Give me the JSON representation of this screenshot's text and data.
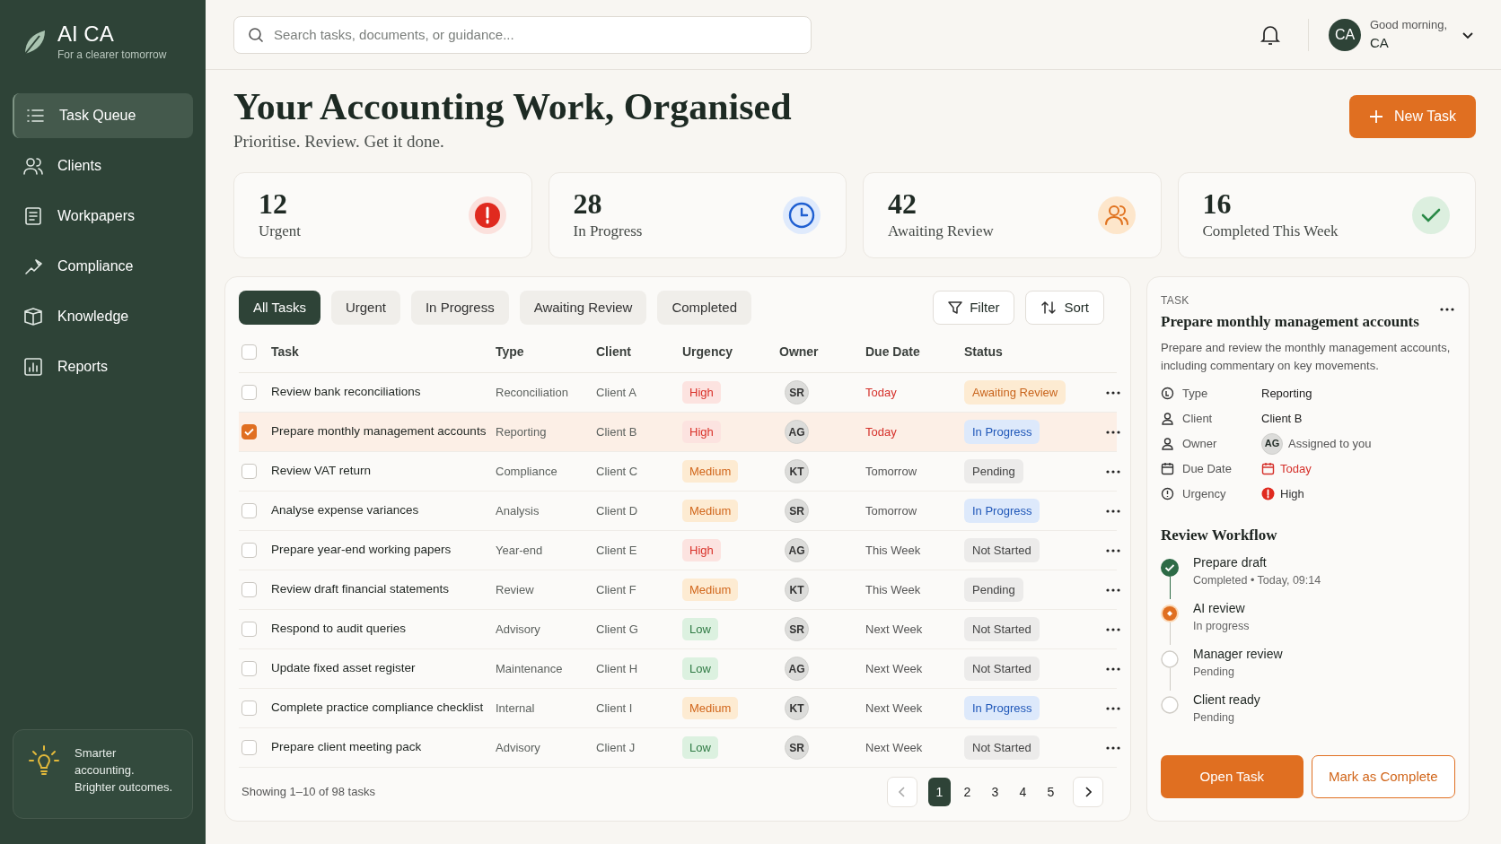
{
  "brand": {
    "name": "AI CA",
    "tagline": "For a clearer tomorrow"
  },
  "nav": [
    {
      "label": "Task Queue",
      "selected": true
    },
    {
      "label": "Clients",
      "selected": false
    },
    {
      "label": "Workpapers",
      "selected": false
    },
    {
      "label": "Compliance",
      "selected": false
    },
    {
      "label": "Knowledge",
      "selected": false
    },
    {
      "label": "Reports",
      "selected": false
    }
  ],
  "promo": "Smarter accounting. Brighter outcomes.",
  "header": {
    "search_placeholder": "Search tasks, documents, or guidance...",
    "greeting": "Good morning,",
    "user": "CA",
    "avatar": "CA"
  },
  "page": {
    "title": "Your Accounting Work, Organised",
    "subtitle": "Prioritise. Review. Get it done.",
    "new_button": "New Task"
  },
  "stats": [
    {
      "value": "12",
      "label": "Urgent",
      "kind": "urgent"
    },
    {
      "value": "28",
      "label": "In Progress",
      "kind": "progress"
    },
    {
      "value": "42",
      "label": "Awaiting Review",
      "kind": "review"
    },
    {
      "value": "16",
      "label": "Completed This Week",
      "kind": "done"
    }
  ],
  "tabs": [
    {
      "label": "All Tasks",
      "selected": true
    },
    {
      "label": "Urgent",
      "selected": false
    },
    {
      "label": "In Progress",
      "selected": false
    },
    {
      "label": "Awaiting Review",
      "selected": false
    },
    {
      "label": "Completed",
      "selected": false
    }
  ],
  "filter_button": "Filter",
  "sort_button": "Sort",
  "table": {
    "select_all_checked": false,
    "columns": [
      "Task",
      "Type",
      "Client",
      "Urgency",
      "Owner",
      "Due Date",
      "Status"
    ],
    "rows": [
      {
        "task": "Review bank reconciliations",
        "type": "Reconciliation",
        "client": "Client A",
        "urgency": {
          "label": "High",
          "kind": "high"
        },
        "owner": "SR",
        "due": "Today",
        "due_soon": true,
        "status": {
          "label": "Awaiting Review",
          "kind": "review"
        },
        "checked": false,
        "selected": false
      },
      {
        "task": "Prepare monthly management accounts",
        "type": "Reporting",
        "client": "Client B",
        "urgency": {
          "label": "High",
          "kind": "high"
        },
        "owner": "AG",
        "due": "Today",
        "due_soon": true,
        "status": {
          "label": "In Progress",
          "kind": "progress"
        },
        "checked": true,
        "selected": true
      },
      {
        "task": "Review VAT return",
        "type": "Compliance",
        "client": "Client C",
        "urgency": {
          "label": "Medium",
          "kind": "medium"
        },
        "owner": "KT",
        "due": "Tomorrow",
        "due_soon": false,
        "status": {
          "label": "Pending",
          "kind": "neutral"
        },
        "checked": false,
        "selected": false
      },
      {
        "task": "Analyse expense variances",
        "type": "Analysis",
        "client": "Client D",
        "urgency": {
          "label": "Medium",
          "kind": "medium"
        },
        "owner": "SR",
        "due": "Tomorrow",
        "due_soon": false,
        "status": {
          "label": "In Progress",
          "kind": "progress"
        },
        "checked": false,
        "selected": false
      },
      {
        "task": "Prepare year-end working papers",
        "type": "Year-end",
        "client": "Client E",
        "urgency": {
          "label": "High",
          "kind": "high"
        },
        "owner": "AG",
        "due": "This Week",
        "due_soon": false,
        "status": {
          "label": "Not Started",
          "kind": "neutral"
        },
        "checked": false,
        "selected": false
      },
      {
        "task": "Review draft financial statements",
        "type": "Review",
        "client": "Client F",
        "urgency": {
          "label": "Medium",
          "kind": "medium"
        },
        "owner": "KT",
        "due": "This Week",
        "due_soon": false,
        "status": {
          "label": "Pending",
          "kind": "neutral"
        },
        "checked": false,
        "selected": false
      },
      {
        "task": "Respond to audit queries",
        "type": "Advisory",
        "client": "Client G",
        "urgency": {
          "label": "Low",
          "kind": "low"
        },
        "owner": "SR",
        "due": "Next Week",
        "due_soon": false,
        "status": {
          "label": "Not Started",
          "kind": "neutral"
        },
        "checked": false,
        "selected": false
      },
      {
        "task": "Update fixed asset register",
        "type": "Maintenance",
        "client": "Client H",
        "urgency": {
          "label": "Low",
          "kind": "low"
        },
        "owner": "AG",
        "due": "Next Week",
        "due_soon": false,
        "status": {
          "label": "Not Started",
          "kind": "neutral"
        },
        "checked": false,
        "selected": false
      },
      {
        "task": "Complete practice compliance checklist",
        "type": "Internal",
        "client": "Client I",
        "urgency": {
          "label": "Medium",
          "kind": "medium"
        },
        "owner": "KT",
        "due": "Next Week",
        "due_soon": false,
        "status": {
          "label": "In Progress",
          "kind": "progress"
        },
        "checked": false,
        "selected": false
      },
      {
        "task": "Prepare client meeting pack",
        "type": "Advisory",
        "client": "Client J",
        "urgency": {
          "label": "Low",
          "kind": "low"
        },
        "owner": "SR",
        "due": "Next Week",
        "due_soon": false,
        "status": {
          "label": "Not Started",
          "kind": "neutral"
        },
        "checked": false,
        "selected": false
      }
    ]
  },
  "footer": {
    "showing": "Showing 1–10 of 98 tasks",
    "pages": [
      {
        "label": "1",
        "selected": true
      },
      {
        "label": "2",
        "selected": false
      },
      {
        "label": "3",
        "selected": false
      },
      {
        "label": "4",
        "selected": false
      },
      {
        "label": "5",
        "selected": false
      }
    ]
  },
  "detail": {
    "eyebrow": "TASK",
    "title": "Prepare monthly management accounts",
    "description": "Prepare and review the monthly management accounts, including commentary on key movements.",
    "fields": [
      {
        "kind": "type",
        "label": "Type",
        "value": "Reporting"
      },
      {
        "kind": "client",
        "label": "Client",
        "value": "Client B"
      },
      {
        "kind": "owner",
        "label": "Owner",
        "avatar": "AG",
        "value": "Assigned to you"
      },
      {
        "kind": "due",
        "label": "Due Date",
        "value": "Today"
      },
      {
        "kind": "urgency",
        "label": "Urgency",
        "value": "High"
      }
    ],
    "workflow_title": "Review Workflow",
    "steps": [
      {
        "title": "Prepare draft",
        "detail": "Completed • Today, 09:14",
        "done": true,
        "active": false
      },
      {
        "title": "AI review",
        "detail": "In progress",
        "done": false,
        "active": true
      },
      {
        "title": "Manager review",
        "detail": "Pending",
        "done": false,
        "active": false
      },
      {
        "title": "Client ready",
        "detail": "Pending",
        "done": false,
        "active": false
      }
    ],
    "primary_button": "Open Task",
    "secondary_button": "Mark as Complete"
  }
}
